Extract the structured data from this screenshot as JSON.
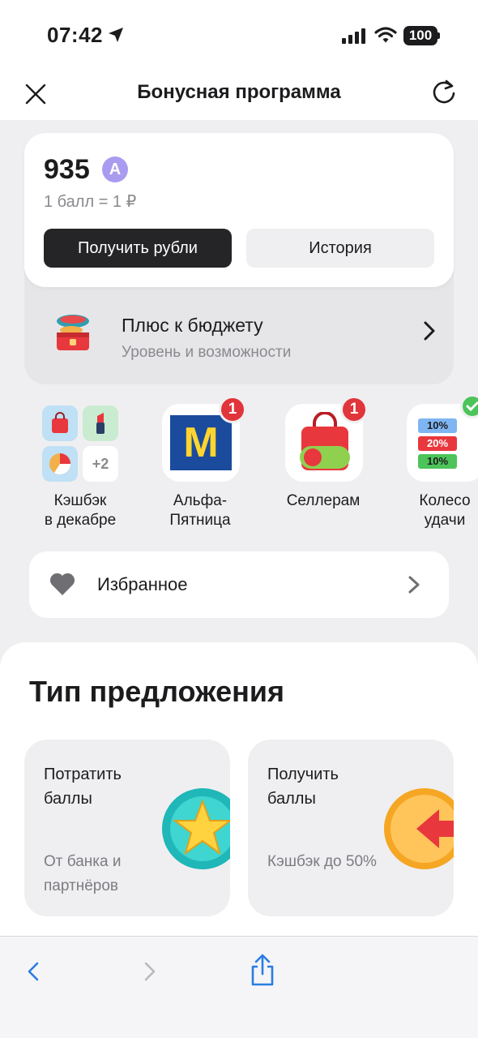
{
  "status_bar": {
    "time": "07:42",
    "battery": "100"
  },
  "header": {
    "title": "Бонусная программа"
  },
  "balance": {
    "value": "935",
    "currency_badge": "A",
    "rate": "1 балл = 1 ₽",
    "get_rubles_label": "Получить рубли",
    "history_label": "История"
  },
  "level": {
    "title": "Плюс к бюджету",
    "subtitle": "Уровень и возможности"
  },
  "stories": [
    {
      "label_line1": "Кэшбэк",
      "label_line2": "в декабре",
      "more": "+2"
    },
    {
      "label_line1": "Альфа-",
      "label_line2": "Пятница",
      "badge": "1",
      "logo_letter": "M"
    },
    {
      "label_line1": "Селлерам",
      "label_line2": "",
      "badge": "1"
    },
    {
      "label_line1": "Колесо",
      "label_line2": "удачи",
      "wheel": [
        "10%",
        "20%",
        "10%"
      ]
    }
  ],
  "favorites": {
    "label": "Избранное"
  },
  "offers": {
    "title": "Тип предложения",
    "cards": [
      {
        "name_line1": "Потратить",
        "name_line2": "баллы",
        "sub_line1": "От банка и",
        "sub_line2": "партнёров"
      },
      {
        "name_line1": "Получить",
        "name_line2": "баллы",
        "sub_line1": "Кэшбэк до 50%",
        "sub_line2": ""
      }
    ]
  },
  "icons": {
    "close": "close-icon",
    "refresh": "refresh-icon",
    "chevron": "chevron-right-icon",
    "heart": "heart-icon",
    "back": "back-icon",
    "forward": "forward-icon",
    "share": "share-icon"
  },
  "colors": {
    "accent_badge": "#a99cf0",
    "notification": "#e2343b",
    "dark_button": "#252528"
  }
}
